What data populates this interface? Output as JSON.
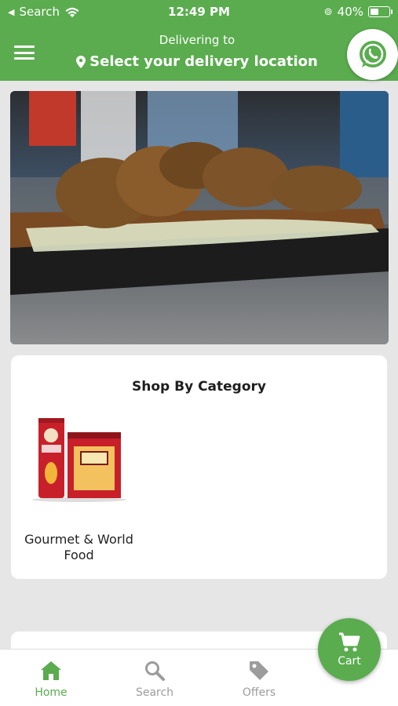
{
  "status_bar": {
    "back_label": "Search",
    "time": "12:49 PM",
    "battery": "40%"
  },
  "header": {
    "delivering_to": "Delivering to",
    "location_prompt": "Select your delivery location"
  },
  "banner": {
    "alt": "banner-image"
  },
  "category": {
    "title": "Shop By Category",
    "items": [
      {
        "label": "Gourmet & World Food"
      }
    ]
  },
  "tabs": [
    {
      "label": "Home"
    },
    {
      "label": "Search"
    },
    {
      "label": "Offers"
    }
  ],
  "cart": {
    "label": "Cart"
  },
  "colors": {
    "brand": "#5aac4e"
  }
}
